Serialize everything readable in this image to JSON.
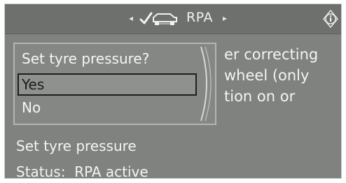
{
  "header": {
    "title": "RPA",
    "left_arrow": "◂",
    "right_arrow": "▸",
    "icons": [
      "rpa-car-check-icon",
      "info-icon"
    ]
  },
  "background_text": {
    "lines": [
      "er correcting",
      "wheel (only",
      "tion on or"
    ]
  },
  "popup": {
    "title": "Set tyre pressure?",
    "options": [
      {
        "label": "Yes",
        "selected": true
      },
      {
        "label": "No",
        "selected": false
      }
    ]
  },
  "bottom": {
    "action_label": "Set tyre pressure",
    "status_prefix": "Status:",
    "status_value": "RPA active"
  },
  "colors": {
    "screen_bg": "#80827f",
    "header_bg": "#6e706d",
    "text": "#f2f2f0",
    "selection_border": "#1e1f1e"
  }
}
